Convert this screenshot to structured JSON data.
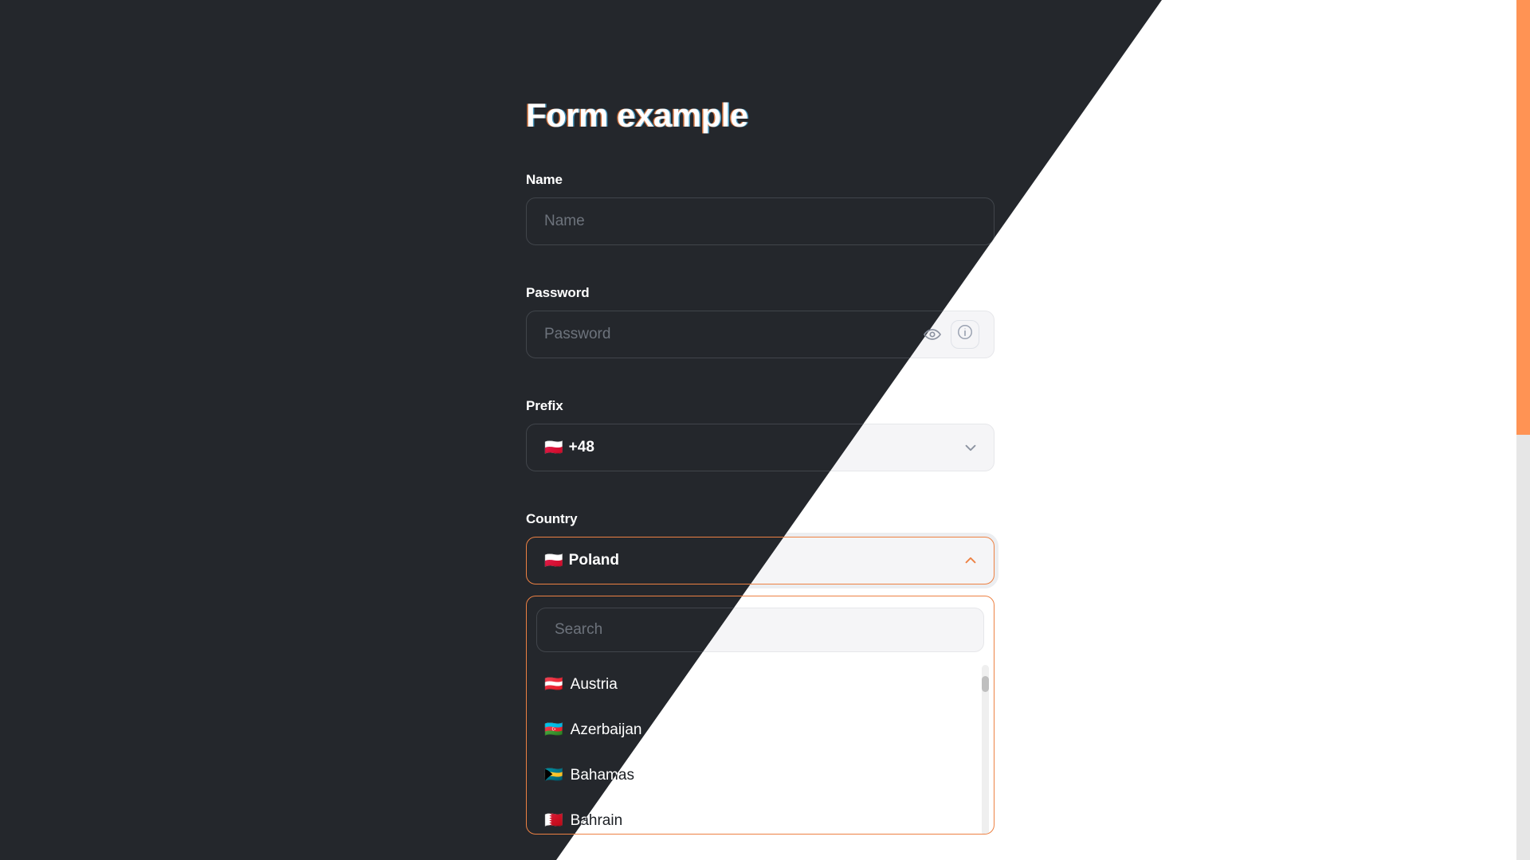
{
  "page": {
    "title": "Form example",
    "accent_color": "#ed8143",
    "dark_bg": "#24272c",
    "light_bg": "#ffffff",
    "scrollbar_thumb_color": "#ff9354",
    "scrollbar_track_color": "#e6e6e6"
  },
  "form": {
    "name_field": {
      "label": "Name",
      "placeholder": "Name",
      "value": ""
    },
    "password_field": {
      "label": "Password",
      "placeholder": "Password",
      "value": "",
      "toggle_icon": "eye-icon",
      "info_icon": "info-icon"
    },
    "prefix_field": {
      "label": "Prefix",
      "flag": "🇵🇱",
      "value": "+48",
      "chevron_icon": "chevron-down-icon"
    },
    "country_field": {
      "label": "Country",
      "flag": "🇵🇱",
      "value": "Poland",
      "chevron_icon": "chevron-up-icon",
      "expanded": "true"
    }
  },
  "dropdown": {
    "search_placeholder": "Search",
    "search_value": "",
    "options": [
      {
        "flag": "🇦🇹",
        "label": "Austria"
      },
      {
        "flag": "🇦🇿",
        "label": "Azerbaijan"
      },
      {
        "flag": "🇧🇸",
        "label": "Bahamas"
      },
      {
        "flag": "🇧🇭",
        "label": "Bahrain"
      }
    ]
  }
}
